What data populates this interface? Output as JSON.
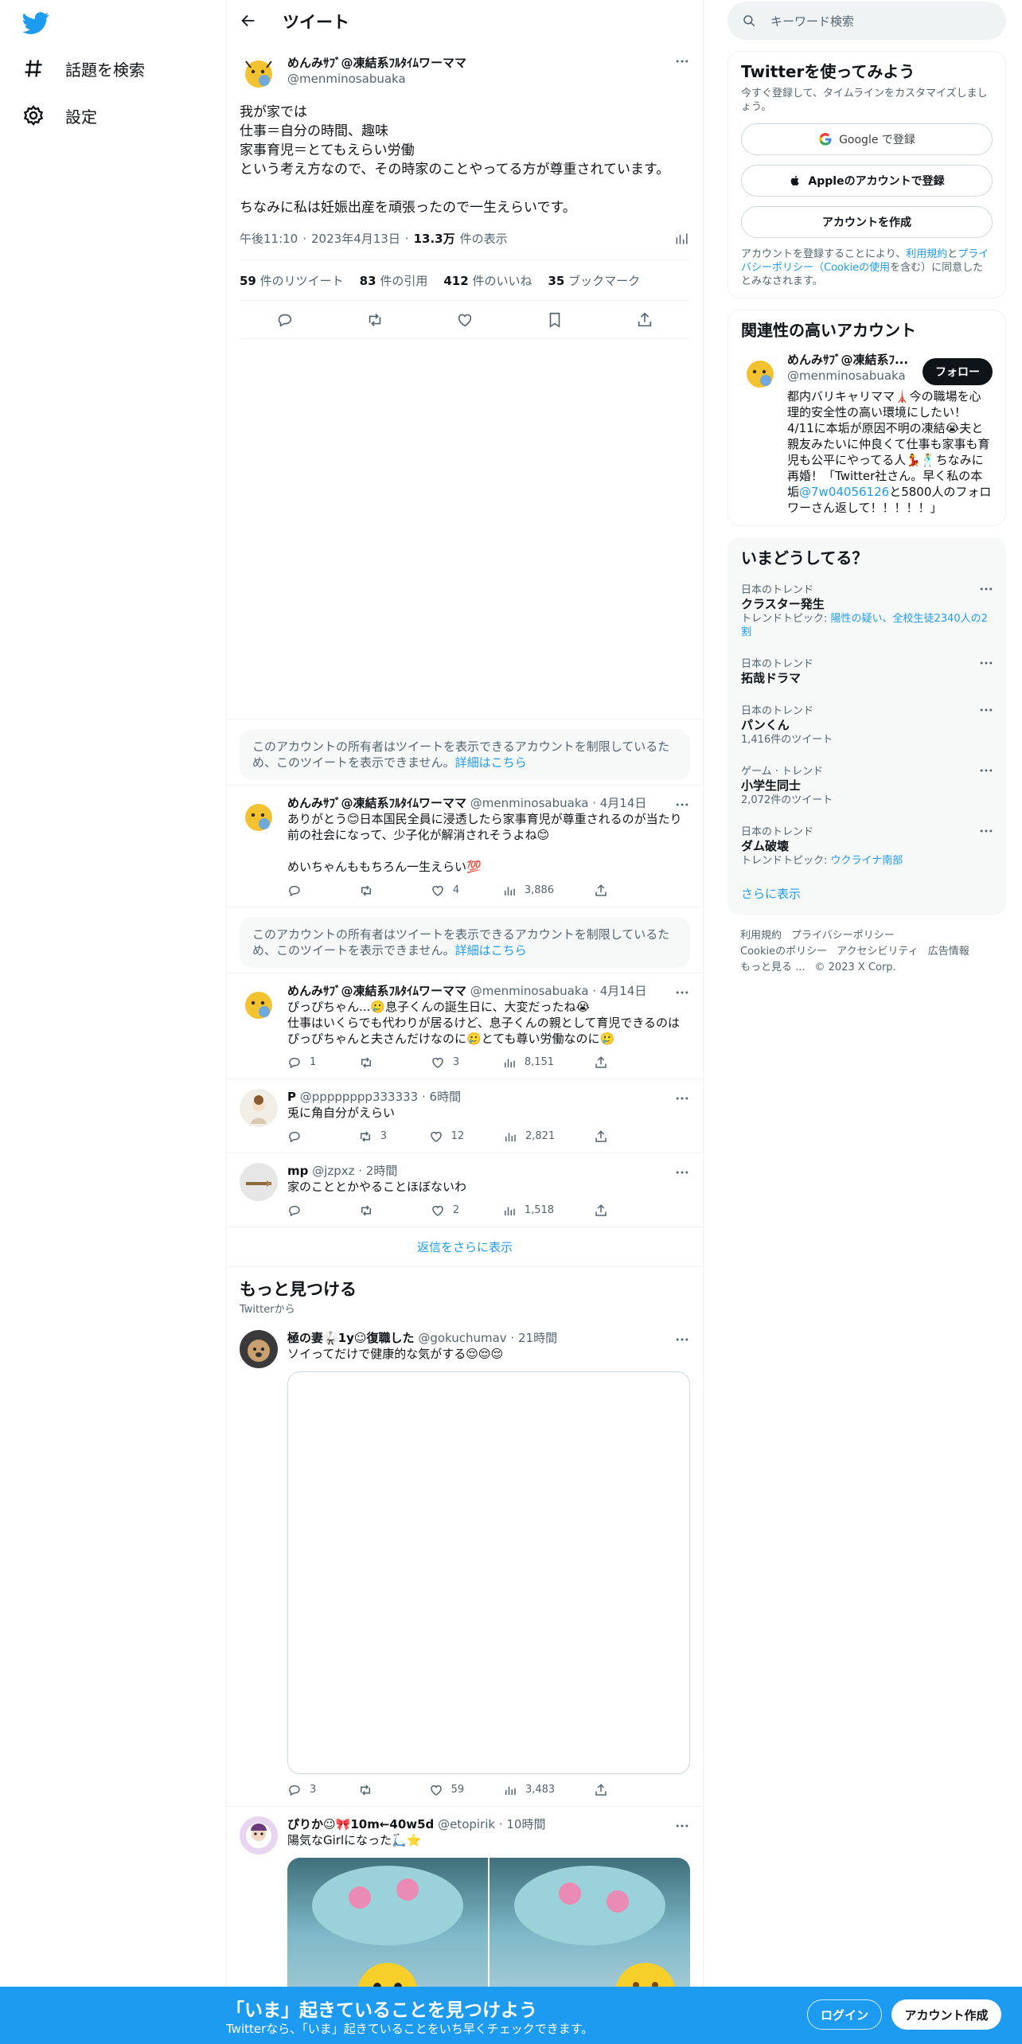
{
  "nav": {
    "explore_label": "話題を検索",
    "settings_label": "設定"
  },
  "header": {
    "title": "ツイート"
  },
  "main_tweet": {
    "display_name": "めんみｻﾌﾞ@凍結系ﾌﾙﾀｲﾑワーママ",
    "handle": "@menminosabuaka",
    "text": "我が家では\n仕事＝自分の時間、趣味\n家事育児＝とてもえらい労働\nという考え方なので、その時家のことやってる方が尊重されています。\n\nちなみに私は妊娠出産を頑張ったので一生えらいです。",
    "time": "午後11:10",
    "date": "2023年4月13日",
    "views_count": "13.3万",
    "views_label": "件の表示",
    "stats": [
      {
        "count": "59",
        "label": "件のリツイート"
      },
      {
        "count": "83",
        "label": "件の引用"
      },
      {
        "count": "412",
        "label": "件のいいね"
      },
      {
        "count": "35",
        "label": "ブックマーク"
      }
    ]
  },
  "restricted_notice": {
    "text": "このアカウントの所有者はツイートを表示できるアカウントを制限しているため、このツイートを表示できません。",
    "link": "詳細はこちら"
  },
  "replies": [
    {
      "display_name": "めんみｻﾌﾞ@凍結系ﾌﾙﾀｲﾑワーママ",
      "handle": "@menminosabuaka",
      "time": "4月14日",
      "text": "ありがとう😊日本国民全員に浸透したら家事育児が尊重されるのが当たり前の社会になって、少子化が解消されそうよね😊\n\nめいちゃんももちろん一生えらい💯",
      "reply_count": "",
      "retweet_count": "",
      "like_count": "4",
      "view_count": "3,886"
    },
    {
      "display_name": "めんみｻﾌﾞ@凍結系ﾌﾙﾀｲﾑワーママ",
      "handle": "@menminosabuaka",
      "time": "4月14日",
      "text": "ぴっぴちゃん...🥲息子くんの誕生日に、大変だったね😭\n仕事はいくらでも代わりが居るけど、息子くんの親として育児できるのはぴっぴちゃんと夫さんだけなのに🥲とても尊い労働なのに🥲",
      "reply_count": "1",
      "retweet_count": "",
      "like_count": "3",
      "view_count": "8,151"
    },
    {
      "display_name": "P",
      "handle": "@pppppppp333333",
      "time": "6時間",
      "text": "兎に角自分がえらい",
      "reply_count": "",
      "retweet_count": "3",
      "like_count": "12",
      "view_count": "2,821"
    },
    {
      "display_name": "mp",
      "handle": "@jzpxz",
      "time": "2時間",
      "text": "家のこととかやることほぼないわ",
      "reply_count": "",
      "retweet_count": "",
      "like_count": "2",
      "view_count": "1,518"
    }
  ],
  "show_more_replies": "返信をさらに表示",
  "discover": {
    "title": "もっと見つける",
    "subtitle": "Twitterから",
    "tweets": [
      {
        "display_name": "極の妻🥋1y☺復職した",
        "handle": "@gokuchumav",
        "time": "21時間",
        "text": "ソイってだけで健康的な気がする😌😌😌",
        "reply_count": "3",
        "retweet_count": "",
        "like_count": "59",
        "view_count": "3,483"
      },
      {
        "display_name": "ぴりか☺🎀10m←40w5d",
        "handle": "@etopirik",
        "time": "10時間",
        "text": "陽気なGirlになった🛴⭐"
      }
    ]
  },
  "sidebar": {
    "search_placeholder": "キーワード検索",
    "signup_card": {
      "title": "Twitterを使ってみよう",
      "subtitle": "今すぐ登録して、タイムラインをカスタマイズしましょう。",
      "google_btn": "Google で登録",
      "apple_btn": "Appleのアカウントで登録",
      "create_btn": "アカウントを作成",
      "legal_prefix": "アカウントを登録することにより、",
      "legal_terms": "利用規約",
      "legal_and": "と",
      "legal_privacy": "プライバシーポリシー（Cookieの使用",
      "legal_suffix": "を含む）に同意したとみなされます。"
    },
    "related": {
      "title": "関連性の高いアカウント",
      "display_name": "めんみｻﾌﾞ@凍結系ﾌ...",
      "handle": "@menminosabuaka",
      "follow": "フォロー",
      "bio": "都内バリキャリママ🗼今の職場を心理的安全性の高い環境にしたい！4/11に本垢が原因不明の凍結😭夫と親友みたいに仲良くて仕事も家事も育児も公平にやってる人💃🕺ちなみに再婚！「Twitter社さん。早く私の本垢",
      "bio_link": "@7w04056126",
      "bio_end": "と5800人のフォロワーさん返して！！！！！」"
    },
    "trends_title": "いまどうしてる？",
    "trends": [
      {
        "context": "日本のトレンド",
        "name": "クラスター発生",
        "meta_prefix": "トレンドトピック: ",
        "meta_link": "陽性の疑い、全校生徒2340人の2割"
      },
      {
        "context": "日本のトレンド",
        "name": "拓哉ドラマ",
        "meta_prefix": "",
        "meta_link": ""
      },
      {
        "context": "日本のトレンド",
        "name": "パンくん",
        "meta_prefix": "1,416件のツイート",
        "meta_link": ""
      },
      {
        "context": "ゲーム · トレンド",
        "name": "小学生同士",
        "meta_prefix": "2,072件のツイート",
        "meta_link": ""
      },
      {
        "context": "日本のトレンド",
        "name": "ダム破壊",
        "meta_prefix": "トレンドトピック: ",
        "meta_link": "ウクライナ南部"
      }
    ],
    "trends_more": "さらに表示",
    "footer": [
      "利用規約",
      "プライバシーポリシー",
      "Cookieのポリシー",
      "アクセシビリティ",
      "広告情報",
      "もっと見る ...",
      "© 2023 X Corp."
    ]
  },
  "bottom_bar": {
    "title": "「いま」起きていることを見つけよう",
    "subtitle": "Twitterなら、「いま」起きていることをいち早くチェックできます。",
    "login": "ログイン",
    "signup": "アカウント作成"
  },
  "colors": {
    "accent": "#1d9bf0",
    "text": "#0f1419",
    "secondary": "#536471"
  }
}
